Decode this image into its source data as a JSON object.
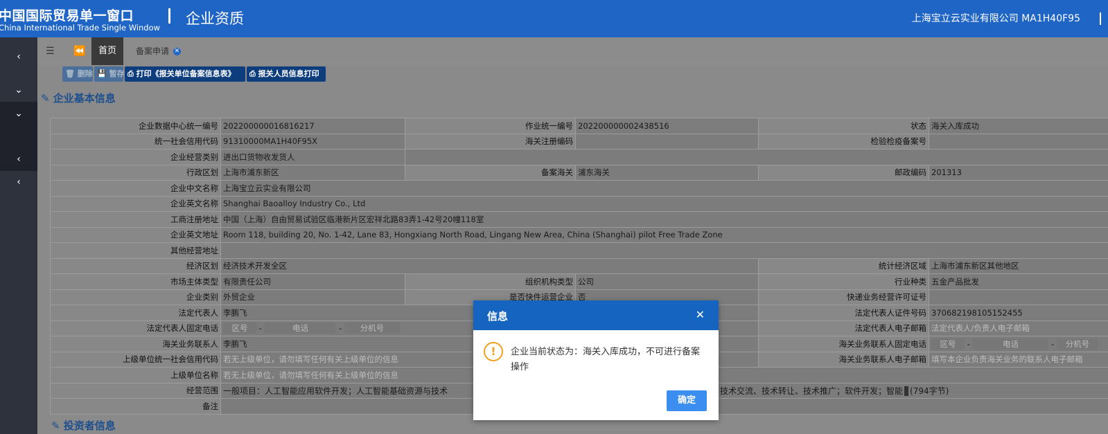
{
  "header": {
    "logo_cn": "中国国际贸易单一窗口",
    "logo_en": "China International Trade Single Window",
    "page_title": "企业资质",
    "company": "上海宝立云实业有限公司 MA1H40F95"
  },
  "sidebar": {
    "items": [
      "‹",
      "⌄",
      "⌄",
      "‹",
      "‹"
    ]
  },
  "tabs": {
    "home": "首页",
    "apply": "备案申请"
  },
  "toolbar": {
    "delete": "删除",
    "save": "暂存",
    "print_info": "打印《报关单位备案信息表》",
    "print_staff": "报关人员信息打印"
  },
  "section": {
    "basic": "企业基本信息",
    "investor": "投资者信息"
  },
  "form": {
    "r1": {
      "l1": "企业数据中心统一编号",
      "v1": "202200000016816217",
      "l2": "作业统一编号",
      "v2": "202200000002438516",
      "l3": "状态",
      "v3": "海关入库成功"
    },
    "r2": {
      "l1": "统一社会信用代码",
      "v1": "91310000MA1H40F95X",
      "l2": "海关注册编码",
      "v2": "",
      "l3": "检验检疫备案号",
      "v3": ""
    },
    "r3": {
      "l1": "企业经营类别",
      "v1": "进出口货物收发货人"
    },
    "r4": {
      "l1": "行政区划",
      "v1": "上海市浦东新区",
      "l2": "备案海关",
      "v2": "浦东海关",
      "l3": "邮政编码",
      "v3": "201313"
    },
    "r5": {
      "l1": "企业中文名称",
      "v1": "上海宝立云实业有限公司"
    },
    "r6": {
      "l1": "企业英文名称",
      "v1": "Shanghai Baoalloy Industry Co., Ltd"
    },
    "r7": {
      "l1": "工商注册地址",
      "v1": "中国（上海）自由贸易试验区临港新片区宏祥北路83弄1-42号20幢118室"
    },
    "r8": {
      "l1": "企业英文地址",
      "v1": "Room 118, building 20, No. 1-42, Lane 83, Hongxiang North Road, Lingang New Area, China (Shanghai) pilot Free Trade Zone"
    },
    "r9": {
      "l1": "其他经营地址",
      "v1": ""
    },
    "r10": {
      "l1": "经济区划",
      "v1": "经济技术开发全区",
      "l3": "统计经济区域",
      "v3": "上海市浦东新区其他地区"
    },
    "r11": {
      "l1": "市场主体类型",
      "v1": "有限责任公司",
      "l2": "组织机构类型",
      "v2": "公司",
      "l3": "行业种类",
      "v3": "五金产品批发"
    },
    "r12": {
      "l1": "企业类别",
      "v1": "外贸企业",
      "l2": "是否快件运营企业",
      "v2": "否",
      "l3": "快递业务经营许可证号",
      "v3": ""
    },
    "r13": {
      "l1": "法定代表人",
      "v1": "李鹏飞",
      "l3": "法定代表人证件号码",
      "v3": "370682198105152455"
    },
    "r14": {
      "l1": "法定代表人固定电话",
      "p1": "区号",
      "p2": "电话",
      "p3": "分机号",
      "l3": "法定代表人电子邮箱",
      "v3": "法定代表人/负责人电子邮箱"
    },
    "r15": {
      "l1": "海关业务联系人",
      "v1": "李鹏飞",
      "l3": "海关业务联系人固定电话",
      "p1": "区号",
      "p2": "电话",
      "p3": "分机号"
    },
    "r16": {
      "l1": "上级单位统一社会信用代码",
      "v1": "若无上级单位，请勿填写任何有关上级单位的信息",
      "l3": "海关业务联系人电子邮箱",
      "v3": "填写本企业负责海关业务的联系人电子邮箱"
    },
    "r17": {
      "l1": "上级单位名称",
      "v1": "若无上级单位，请勿填写任何有关上级单位的信息"
    },
    "r18": {
      "l1": "经营范围",
      "v1a": "一般项目：人工智能应用软件开发；人工智能基础资源与技术",
      "v1b": "术咨询、技术交流、技术转让、技术推广；软件开发；智能",
      "count": "(794字节)"
    },
    "r19": {
      "l1": "备注",
      "v1": ""
    }
  },
  "modal": {
    "title": "信息",
    "message": "企业当前状态为：海关入库成功，不可进行备案操作",
    "ok": "确定"
  }
}
